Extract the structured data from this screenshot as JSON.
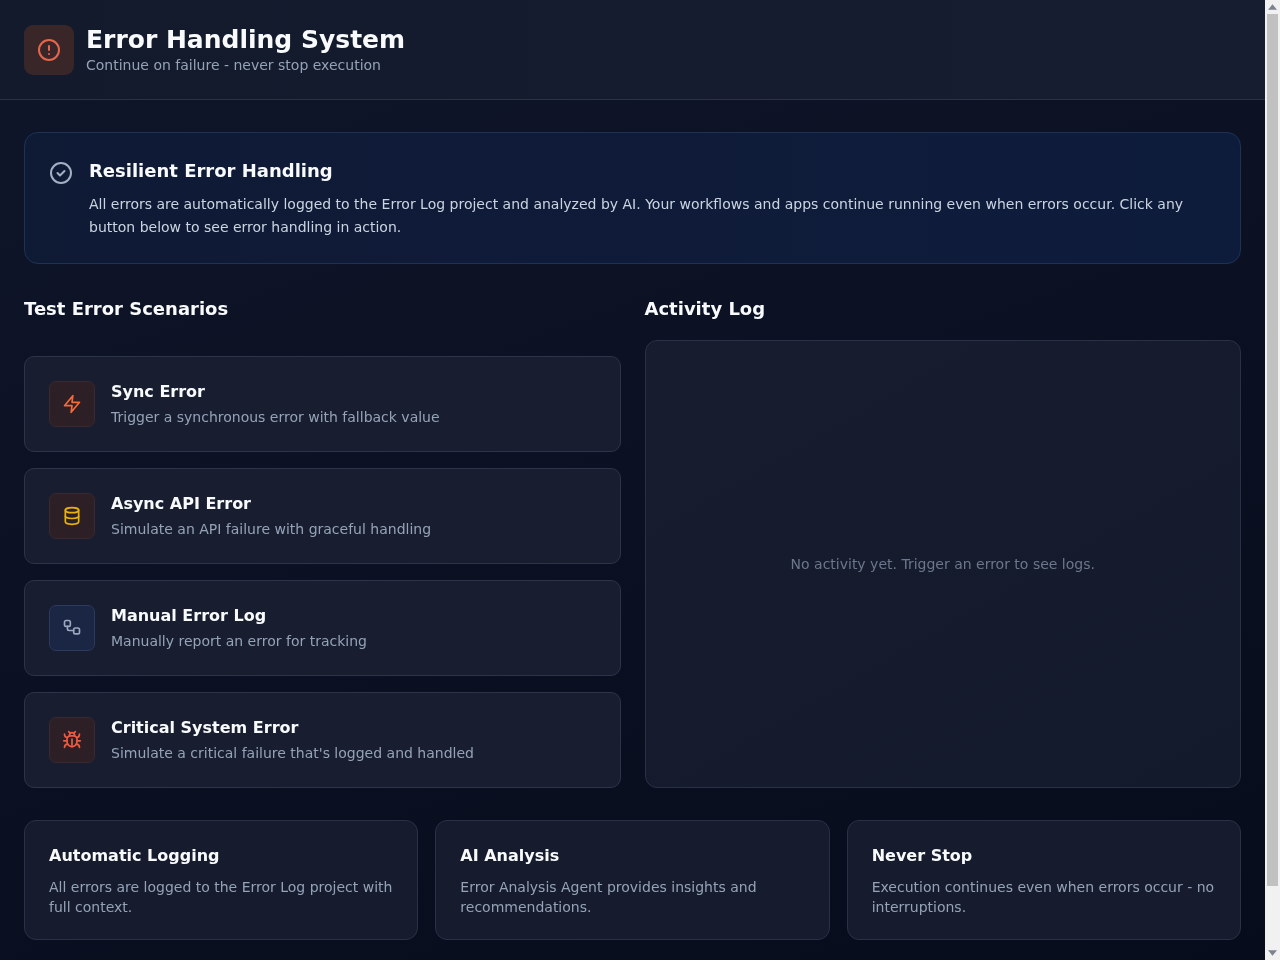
{
  "header": {
    "title": "Error Handling System",
    "subtitle": "Continue on failure - never stop execution"
  },
  "banner": {
    "title": "Resilient Error Handling",
    "text": "All errors are automatically logged to the Error Log project and analyzed by AI. Your workflows and apps continue running even when errors occur. Click any button below to see error handling in action."
  },
  "scenarios": {
    "heading": "Test Error Scenarios",
    "items": [
      {
        "kind": "sync",
        "title": "Sync Error",
        "description": "Trigger a synchronous error with fallback value"
      },
      {
        "kind": "async",
        "title": "Async API Error",
        "description": "Simulate an API failure with graceful handling"
      },
      {
        "kind": "manual",
        "title": "Manual Error Log",
        "description": "Manually report an error for tracking"
      },
      {
        "kind": "critical",
        "title": "Critical System Error",
        "description": "Simulate a critical failure that's logged and handled"
      }
    ]
  },
  "activity_log": {
    "heading": "Activity Log",
    "empty_message": "No activity yet. Trigger an error to see logs."
  },
  "features": [
    {
      "title": "Automatic Logging",
      "description": "All errors are logged to the Error Log project with full context."
    },
    {
      "title": "AI Analysis",
      "description": "Error Analysis Agent provides insights and recommendations."
    },
    {
      "title": "Never Stop",
      "description": "Execution continues even when errors occur - no interruptions."
    }
  ]
}
